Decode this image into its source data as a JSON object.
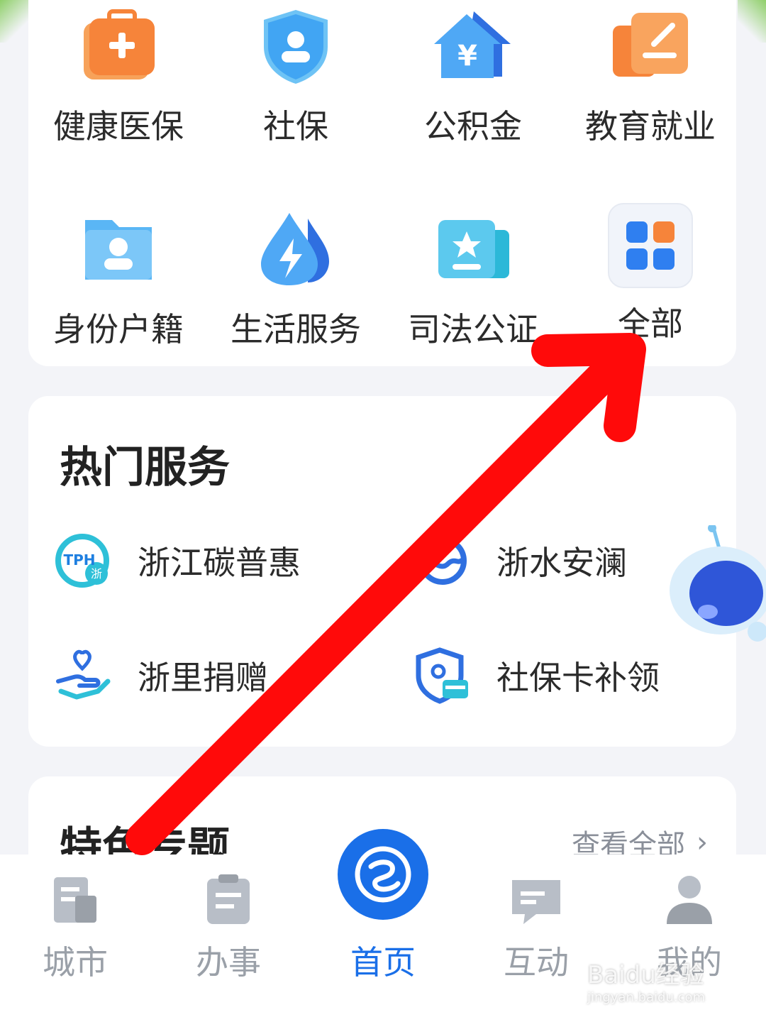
{
  "services": [
    {
      "label": "健康医保",
      "icon": "medical-kit-icon"
    },
    {
      "label": "社保",
      "icon": "shield-person-icon"
    },
    {
      "label": "公积金",
      "icon": "house-yen-icon"
    },
    {
      "label": "教育就业",
      "icon": "certificate-pen-icon"
    },
    {
      "label": "身份户籍",
      "icon": "id-folder-icon"
    },
    {
      "label": "生活服务",
      "icon": "water-drop-bolt-icon"
    },
    {
      "label": "司法公证",
      "icon": "star-badge-icon"
    },
    {
      "label": "全部",
      "icon": "grid-all-icon"
    }
  ],
  "hot": {
    "title": "热门服务",
    "items": [
      {
        "label": "浙江碳普惠",
        "icon": "tph-logo-icon",
        "logo_text": "TPH",
        "logo_sub": "浙"
      },
      {
        "label": "浙水安澜",
        "icon": "water-wave-icon"
      },
      {
        "label": "浙里捐赠",
        "icon": "hand-heart-icon"
      },
      {
        "label": "社保卡补领",
        "icon": "shield-card-icon"
      }
    ]
  },
  "topics": {
    "title": "特色专题",
    "more_label": "查看全部"
  },
  "tabbar": {
    "tabs": [
      {
        "label": "城市",
        "icon": "city-icon"
      },
      {
        "label": "办事",
        "icon": "clipboard-icon"
      },
      {
        "label": "首页",
        "icon": "home-logo-icon"
      },
      {
        "label": "互动",
        "icon": "chat-icon"
      },
      {
        "label": "我的",
        "icon": "user-icon"
      }
    ],
    "active_index": 2
  },
  "watermark": {
    "brand": "Baidu经验",
    "domain": "jingyan.baidu.com"
  },
  "colors": {
    "accent": "#1a6fe8",
    "arrow": "#ff0a0a",
    "orange": "#f6843a",
    "blue": "#3aa0f2"
  }
}
